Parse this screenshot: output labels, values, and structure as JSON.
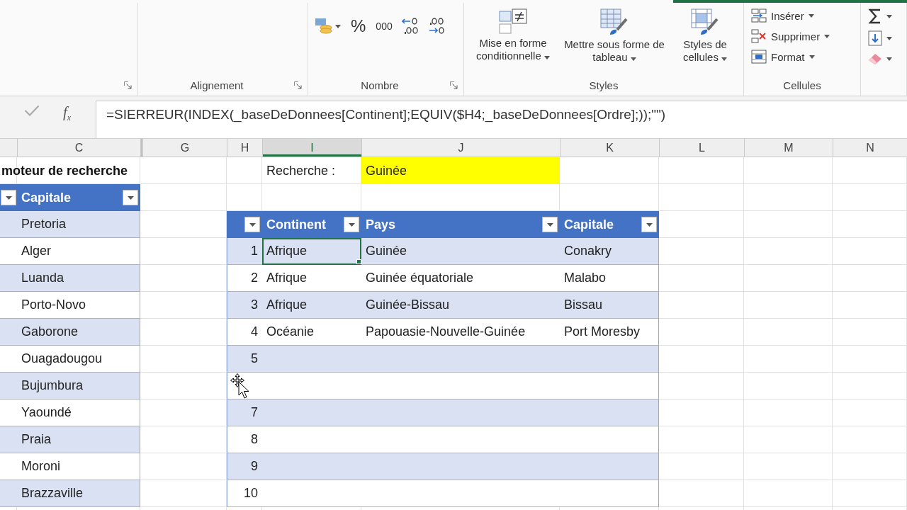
{
  "ribbon": {
    "groups": [
      {
        "kind": "cut",
        "launcher": true
      },
      {
        "kind": "empty",
        "label": "Alignement",
        "launcher": true
      },
      {
        "kind": "number",
        "label": "Nombre",
        "launcher": true,
        "symbols": [
          "%",
          "000"
        ]
      },
      {
        "kind": "styles",
        "label": "Styles",
        "buttons": [
          {
            "label": "Mise en forme conditionnelle",
            "dropdown": true
          },
          {
            "label": "Mettre sous forme de tableau",
            "dropdown": true
          },
          {
            "label": "Styles de cellules",
            "dropdown": true
          }
        ]
      },
      {
        "kind": "cells",
        "label": "Cellules",
        "buttons": [
          {
            "label": "Insérer",
            "dropdown": true
          },
          {
            "label": "Supprimer",
            "dropdown": true
          },
          {
            "label": "Format",
            "dropdown": true
          }
        ]
      },
      {
        "kind": "editing",
        "buttons": [
          {
            "dropdown": true
          },
          {
            "dropdown": true
          },
          {
            "dropdown": true
          }
        ]
      }
    ]
  },
  "formula_bar": {
    "function_button": "f$_{x}$",
    "formula": "=SIERREUR(INDEX(_baseDeDonnees[Continent];EQUIV($H4;_baseDeDonnees[Ordre];));\"\")"
  },
  "column_headers": [
    {
      "label": "C",
      "selected": false
    },
    {
      "label": "G",
      "selected": false
    },
    {
      "label": "H",
      "selected": false
    },
    {
      "label": "I",
      "selected": true
    },
    {
      "label": "J",
      "selected": false
    },
    {
      "label": "K",
      "selected": false
    },
    {
      "label": "L",
      "selected": false
    },
    {
      "label": "M",
      "selected": false
    },
    {
      "label": "N",
      "selected": false
    }
  ],
  "sheet_title": "moteur de recherche",
  "search": {
    "label": "Recherche :",
    "value": "Guinée"
  },
  "left_table": {
    "header": "Capitale",
    "rows": [
      "Pretoria",
      "Alger",
      "Luanda",
      "Porto-Novo",
      "Gaborone",
      "Ouagadougou",
      "Bujumbura",
      "Yaoundé",
      "Praia",
      "Moroni",
      "Brazzaville"
    ]
  },
  "result_table": {
    "headers": [
      "Continent",
      "Pays",
      "Capitale"
    ],
    "rows": [
      {
        "number": "1",
        "cursor": false,
        "cells": [
          {
            "text": "Afrique",
            "selected": true
          },
          {
            "text": "Guinée",
            "selected": false
          },
          {
            "text": "Conakry",
            "selected": false
          }
        ]
      },
      {
        "number": "2",
        "cursor": false,
        "cells": [
          {
            "text": "Afrique",
            "selected": false
          },
          {
            "text": "Guinée équatoriale",
            "selected": false
          },
          {
            "text": "Malabo",
            "selected": false
          }
        ]
      },
      {
        "number": "3",
        "cursor": false,
        "cells": [
          {
            "text": "Afrique",
            "selected": false
          },
          {
            "text": "Guinée-Bissau",
            "selected": false
          },
          {
            "text": "Bissau",
            "selected": false
          }
        ]
      },
      {
        "number": "4",
        "cursor": false,
        "cells": [
          {
            "text": "Océanie",
            "selected": false
          },
          {
            "text": "Papouasie-Nouvelle-Guinée",
            "selected": false
          },
          {
            "text": "Port Moresby",
            "selected": false
          }
        ]
      },
      {
        "number": "5",
        "cursor": false
      },
      {
        "cursor": true
      },
      {
        "number": "7",
        "cursor": false
      },
      {
        "number": "8",
        "cursor": false
      },
      {
        "number": "9",
        "cursor": false
      },
      {
        "number": "10",
        "cursor": false
      }
    ]
  }
}
